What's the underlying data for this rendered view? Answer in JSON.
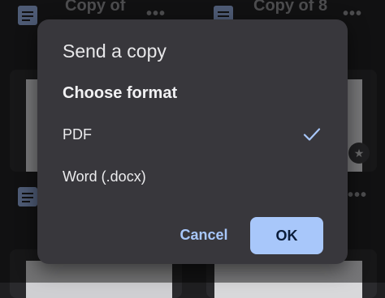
{
  "background": {
    "docs": [
      {
        "title": "Copy of",
        "icon": "google-docs-icon",
        "more": "•••"
      },
      {
        "title": "Copy of 8",
        "icon": "google-docs-icon",
        "more": "•••"
      }
    ],
    "star_badge": "★",
    "row2_more": "•••"
  },
  "dialog": {
    "title": "Send a copy",
    "subtitle": "Choose format",
    "options": [
      {
        "label": "PDF",
        "selected": true
      },
      {
        "label": "Word (.docx)",
        "selected": false
      }
    ],
    "cancel_label": "Cancel",
    "ok_label": "OK"
  },
  "colors": {
    "accent": "#a8c7fa",
    "dialog_bg": "#38373c",
    "docs_icon": "#8fa7d6"
  }
}
